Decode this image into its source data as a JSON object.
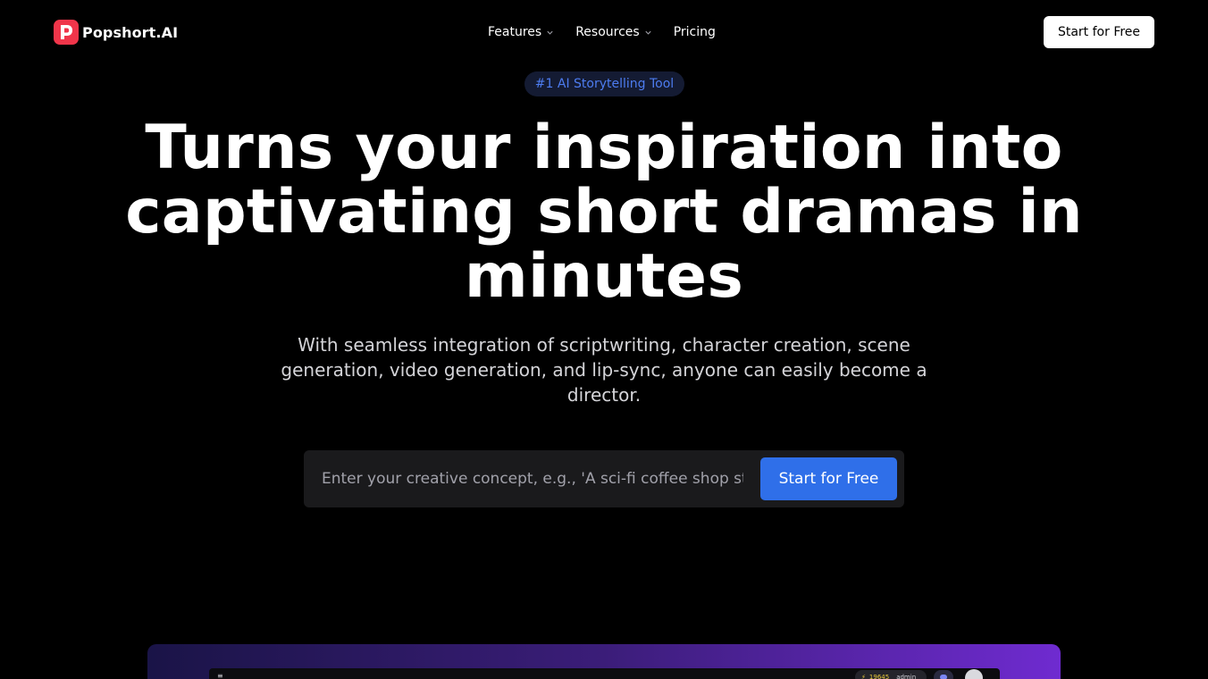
{
  "brand": {
    "name": "Popshort.AI",
    "logo_icon": "popshort-logo-icon",
    "accent": "#f0354a"
  },
  "nav": {
    "items": [
      {
        "label": "Features",
        "icon": "chevron-down-icon"
      },
      {
        "label": "Resources",
        "icon": "chevron-down-icon"
      },
      {
        "label": "Pricing"
      }
    ],
    "cta_label": "Start for Free"
  },
  "hero": {
    "badge": "#1 AI Storytelling Tool",
    "headline": "Turns your inspiration into captivating short dramas in minutes",
    "subtitle": "With seamless integration of scriptwriting, character creation, scene generation, video generation, and lip-sync, anyone can easily become a director."
  },
  "prompt": {
    "placeholder": "Enter your creative concept, e.g., 'A sci-fi coffee shop story'",
    "value": "",
    "button_label": "Start for Free"
  },
  "preview": {
    "credits": "19645",
    "username": "admin",
    "menu_icon": "hamburger-icon",
    "discord_icon": "discord-icon"
  },
  "colors": {
    "background": "#000000",
    "primary_button": "#2f6fe9",
    "badge_text": "#4d7cf0"
  }
}
